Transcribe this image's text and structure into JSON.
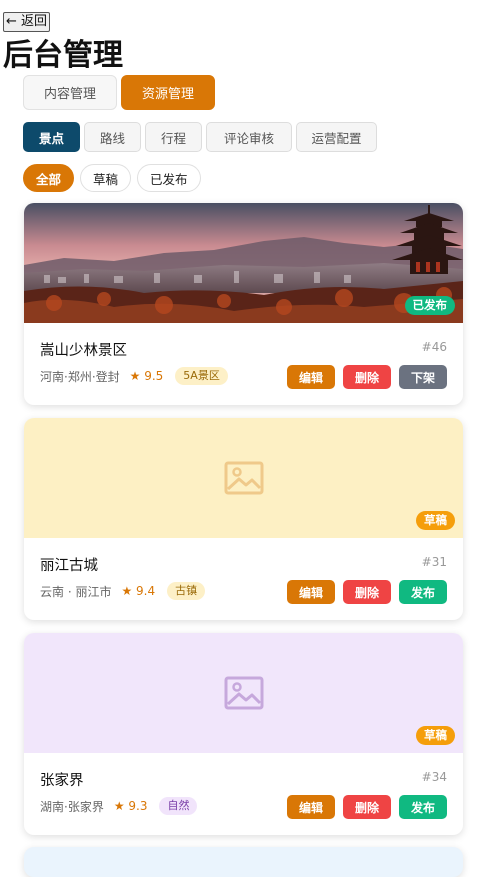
{
  "header": {
    "back_label": "← 返回",
    "title": "后台管理"
  },
  "main_tabs": [
    {
      "label": "内容管理",
      "active": false
    },
    {
      "label": "资源管理",
      "active": true
    }
  ],
  "sub_tabs": [
    {
      "label": "景点",
      "active": true
    },
    {
      "label": "路线",
      "active": false
    },
    {
      "label": "行程",
      "active": false
    },
    {
      "label": "评论审核",
      "active": false
    },
    {
      "label": "运营配置",
      "active": false
    }
  ],
  "filters": [
    {
      "label": "全部",
      "active": true
    },
    {
      "label": "草稿",
      "active": false
    },
    {
      "label": "已发布",
      "active": false
    }
  ],
  "colors": {
    "accent": "#d97706",
    "navy": "#0d4a6b",
    "delete": "#ef4444",
    "publish": "#10b981",
    "unpublish": "#6b7280",
    "draft_badge": "#f59e0b"
  },
  "cards": [
    {
      "image": "photo-pagoda-city",
      "status": "已发布",
      "name": "嵩山少林景区",
      "id": "#46",
      "location": "河南·郑州·登封",
      "rating": "★ 9.5",
      "tag": "5A景区",
      "actions": [
        "编辑",
        "删除",
        "下架"
      ]
    },
    {
      "image": "image-placeholder-icon",
      "status": "草稿",
      "name": "丽江古城",
      "id": "#31",
      "location": "云南 · 丽江市",
      "rating": "★ 9.4",
      "tag": "古镇",
      "actions": [
        "编辑",
        "删除",
        "发布"
      ]
    },
    {
      "image": "image-placeholder-icon",
      "status": "草稿",
      "name": "张家界",
      "id": "#34",
      "location": "湖南·张家界",
      "rating": "★ 9.3",
      "tag": "自然",
      "actions": [
        "编辑",
        "删除",
        "发布"
      ]
    }
  ]
}
